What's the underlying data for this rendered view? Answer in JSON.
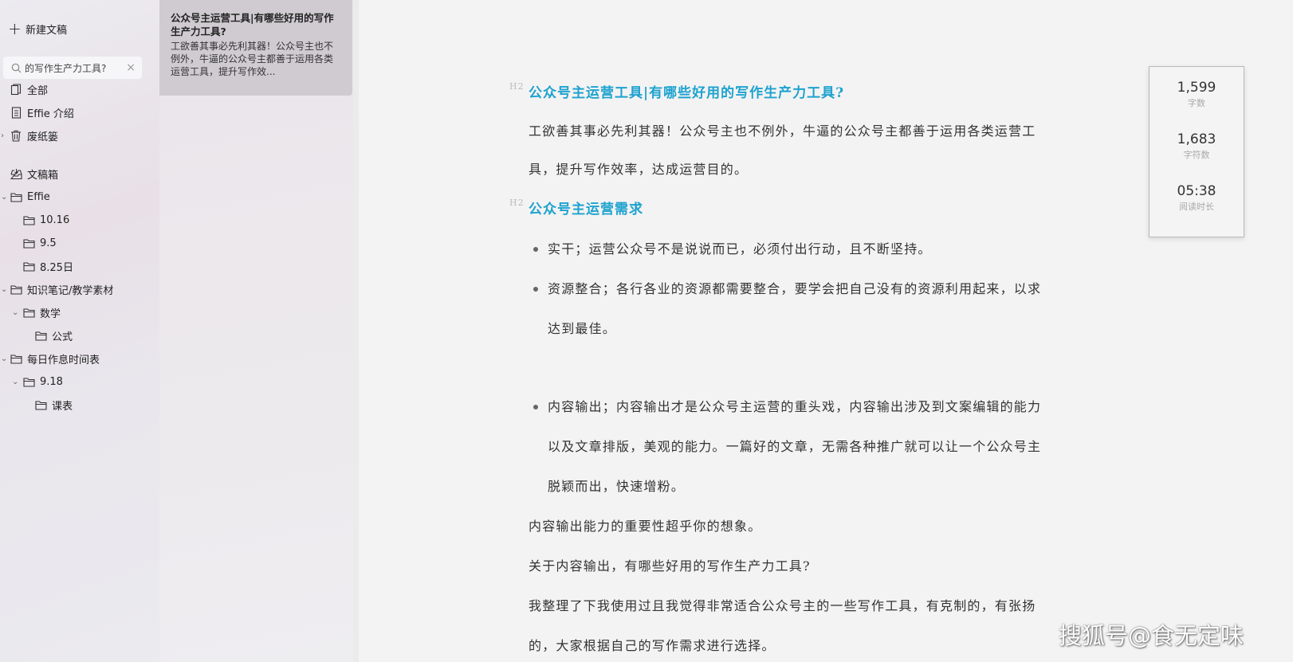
{
  "sidebar": {
    "new_doc_label": "新建文稿",
    "search_value": "的写作生产力工具?",
    "search_clear": "×",
    "items": [
      {
        "label": "全部",
        "icon": "documents-icon"
      },
      {
        "label": "Effie 介绍",
        "icon": "document-icon"
      },
      {
        "label": "废纸篓",
        "icon": "trash-icon"
      },
      {
        "label": "文稿箱",
        "icon": "inbox-icon"
      },
      {
        "label": "Effie",
        "icon": "folder-icon"
      },
      {
        "label": "10.16",
        "icon": "folder-icon"
      },
      {
        "label": "9.5",
        "icon": "folder-icon"
      },
      {
        "label": "8.25日",
        "icon": "folder-icon"
      },
      {
        "label": "知识笔记/教学素材",
        "icon": "folder-icon"
      },
      {
        "label": "数学",
        "icon": "folder-icon"
      },
      {
        "label": "公式",
        "icon": "folder-icon"
      },
      {
        "label": "每日作息时间表",
        "icon": "folder-icon"
      },
      {
        "label": "9.18",
        "icon": "folder-icon"
      },
      {
        "label": "课表",
        "icon": "folder-icon"
      }
    ]
  },
  "doclist": {
    "card": {
      "title": "公众号主运营工具|有哪些好用的写作生产力工具?",
      "snippet": "工欲善其事必先利其器！公众号主也不例外，牛逼的公众号主都善于运用各类运营工具，提升写作效..."
    }
  },
  "editor": {
    "heading1": "公众号主运营工具|有哪些好用的写作生产力工具?",
    "para1_line1": "工欲善其事必先利其器！公众号主也不例外，牛逼的公众号主都善于运用各类运营工",
    "para1_line2": "具，提升写作效率，达成运营目的。",
    "heading2": "公众号主运营需求",
    "heading_marker": "H2",
    "bullet1": "实干；运营公众号不是说说而已，必须付出行动，且不断坚持。",
    "bullet2_line1": "资源整合；各行各业的资源都需要整合，要学会把自己没有的资源利用起来，以求",
    "bullet2_line2": "达到最佳。",
    "bullet3_line1": "内容输出；内容输出才是公众号主运营的重头戏，内容输出涉及到文案编辑的能力",
    "bullet3_line2": "以及文章排版，美观的能力。一篇好的文章，无需各种推广就可以让一个公众号主",
    "bullet3_line3": "脱颖而出，快速增粉。",
    "para2": "内容输出能力的重要性超乎你的想象。",
    "para3": "关于内容输出，有哪些好用的写作生产力工具?",
    "para4_line1": "我整理了下我使用过且我觉得非常适合公众号主的一些写作工具，有克制的，有张扬",
    "para4_line2": "的，大家根据自己的写作需求进行选择。"
  },
  "stats": {
    "word_count": "1,599",
    "word_label": "字数",
    "char_count": "1,683",
    "char_label": "字符数",
    "read_time": "05:38",
    "read_label": "阅读时长"
  },
  "watermark": "搜狐号@食无定味",
  "colors": {
    "heading": "#1ea2cf",
    "text": "#333333",
    "card_bg": "#cfcbd0"
  }
}
